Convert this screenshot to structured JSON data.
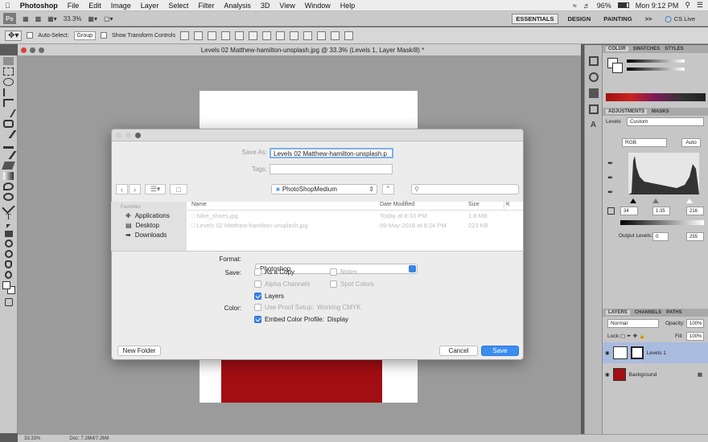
{
  "menubar": {
    "app": "Photoshop",
    "items": [
      "File",
      "Edit",
      "Image",
      "Layer",
      "Select",
      "Filter",
      "Analysis",
      "3D",
      "View",
      "Window",
      "Help"
    ],
    "battery": "96%",
    "clock": "Mon 9:12 PM"
  },
  "appbar": {
    "ps": "Ps",
    "zoom": "33.3%",
    "workspaces": [
      "ESSENTIALS",
      "DESIGN",
      "PAINTING"
    ],
    "more": ">>",
    "cslive": "CS Live"
  },
  "options": {
    "auto_select": "Auto-Select:",
    "group": "Group",
    "transform": "Show Transform Controls"
  },
  "document": {
    "title": "Levels 02 Matthew-hamilton-unsplash.jpg @ 33.3% (Levels 1, Layer Mask/8) *"
  },
  "status": {
    "zoom": "33.33%",
    "doc": "Doc: 7.26M/7.26M"
  },
  "dialog": {
    "save_as_label": "Save As:",
    "filename": "Levels 02 Matthew-hamilton-unsplash.p",
    "tags_label": "Tags:",
    "location": "PhotoShopMedium",
    "sidebar_heading": "Favorites",
    "sidebar": [
      "Applications",
      "Desktop",
      "Downloads"
    ],
    "columns": [
      "Name",
      "Date Modified",
      "Size",
      "K"
    ],
    "files": [
      {
        "name": "Nike_shoes.jpg",
        "date": "Today at 8:33 PM",
        "size": "1.8 MB"
      },
      {
        "name": "Levels 02 Matthew-hamilton-unsplash.jpg",
        "date": "09-May-2018 at 8:24 PM",
        "size": "223 KB"
      }
    ],
    "format_label": "Format:",
    "format_value": "Photoshop",
    "save_label": "Save:",
    "as_a_copy": "As a Copy",
    "notes": "Notes",
    "alpha_channels": "Alpha Channels",
    "spot_colors": "Spot Colors",
    "layers": "Layers",
    "color_label": "Color:",
    "use_proof": "Use Proof Setup:",
    "working_cmyk": "Working CMYK",
    "embed_profile": "Embed Color Profile:",
    "display": "Display",
    "new_folder": "New Folder",
    "cancel": "Cancel",
    "save": "Save"
  },
  "panels": {
    "color_tabs": [
      "COLOR",
      "SWATCHES",
      "STYLES"
    ],
    "adj_tabs": [
      "ADJUSTMENTS",
      "MASKS"
    ],
    "levels_label": "Levels",
    "preset": "Custom",
    "channel": "RGB",
    "auto": "Auto",
    "input_values": [
      "34",
      "1.35",
      "216"
    ],
    "output_label": "Output Levels:",
    "output_values": [
      "0",
      "255"
    ],
    "layer_tabs": [
      "LAYERS",
      "CHANNELS",
      "PATHS"
    ],
    "blend_mode": "Normal",
    "opacity_label": "Opacity:",
    "opacity": "100%",
    "lock_label": "Lock:",
    "fill_label": "Fill:",
    "fill": "100%",
    "layers": [
      "Levels 1",
      "Background"
    ]
  },
  "colors": {
    "accent": "#3a8ef0",
    "image_red": "#a30e12"
  }
}
